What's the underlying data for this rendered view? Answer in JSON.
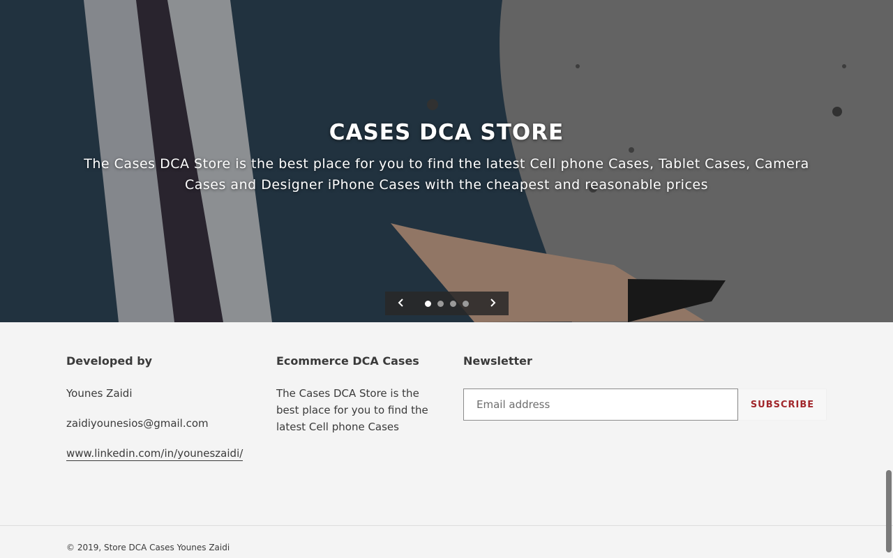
{
  "hero": {
    "title": "CASES DCA STORE",
    "description": "The Cases DCA Store is the best place for you to find the latest Cell phone Cases, Tablet Cases, Camera Cases and Designer iPhone Cases with the cheapest and reasonable prices",
    "slider": {
      "prev_icon": "chevron-left-icon",
      "next_icon": "chevron-right-icon",
      "slide_count": 4,
      "active_slide": 1
    }
  },
  "footer": {
    "developed": {
      "title": "Developed by",
      "name": "Younes Zaidi",
      "email": "zaidiyounesios@gmail.com",
      "linkedin": "www.linkedin.com/in/youneszaidi/"
    },
    "about": {
      "title": "Ecommerce DCA Cases",
      "text": "The Cases DCA Store is the best place for you to find the latest Cell phone Cases"
    },
    "newsletter": {
      "title": "Newsletter",
      "placeholder": "Email address",
      "button_label": "SUBSCRIBE"
    },
    "copyright": "© 2019, Store DCA Cases Younes Zaidi"
  },
  "colors": {
    "accent": "#a1262b",
    "footer_bg": "#f4f4f4",
    "text": "#3a3a3a"
  }
}
